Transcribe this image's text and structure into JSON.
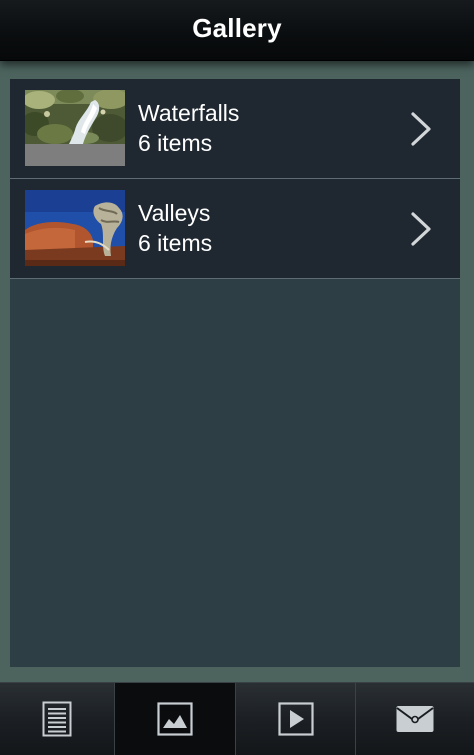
{
  "header": {
    "title": "Gallery"
  },
  "albums": [
    {
      "title": "Waterfalls",
      "count": "6 items",
      "thumbnail": "waterfall-thumbnail"
    },
    {
      "title": "Valleys",
      "count": "6 items",
      "thumbnail": "valley-thumbnail"
    }
  ],
  "tabbar": {
    "tabs": [
      {
        "icon": "document-list-icon",
        "active": false
      },
      {
        "icon": "picture-icon",
        "active": true
      },
      {
        "icon": "play-icon",
        "active": false
      },
      {
        "icon": "envelope-icon",
        "active": false
      }
    ]
  },
  "colors": {
    "background": "#4c635e",
    "content": "#2d3e44",
    "row": "#1f2830",
    "header": "#0b0e10"
  }
}
